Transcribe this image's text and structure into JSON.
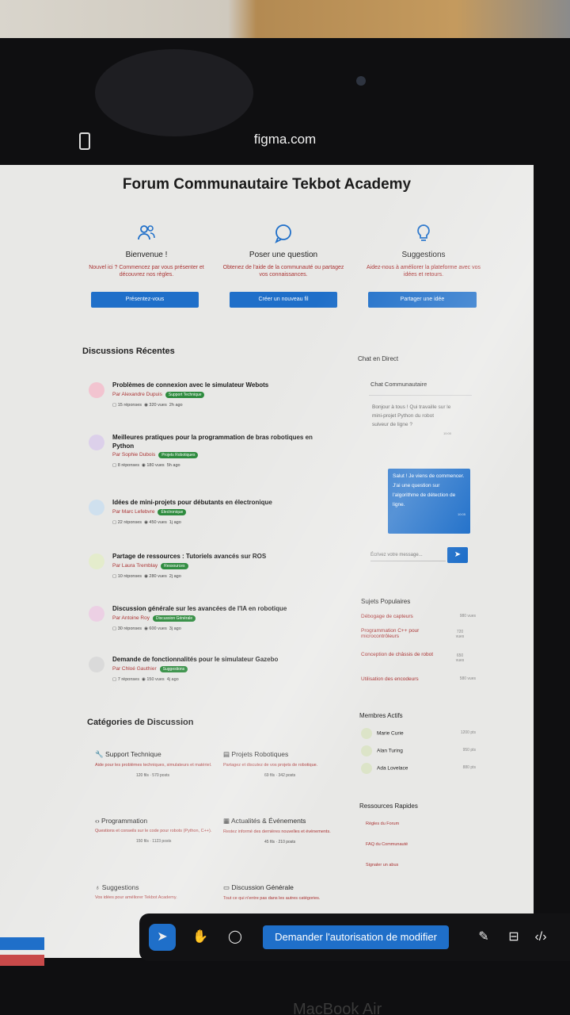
{
  "browser": {
    "url": "figma.com"
  },
  "page": {
    "title": "Forum Communautaire Tekbot Academy"
  },
  "welcome_cards": [
    {
      "title": "Bienvenue !",
      "desc": "Nouvel ici ? Commencez par vous présenter et découvrez nos règles.",
      "button": "Présentez-vous",
      "icon": "users-icon"
    },
    {
      "title": "Poser une question",
      "desc": "Obtenez de l'aide de la communauté ou partagez vos connaissances.",
      "button": "Créer un nouveau fil",
      "icon": "chat-bubble-icon"
    },
    {
      "title": "Suggestions",
      "desc": "Aidez-nous à améliorer la plateforme avec vos idées et retours.",
      "button": "Partager une idée",
      "icon": "lightbulb-icon"
    }
  ],
  "discussions": {
    "title": "Discussions Récentes",
    "items": [
      {
        "title": "Problèmes de connexion avec le simulateur Webots",
        "author": "Par Alexandre Dupuis",
        "tag": "Support Technique",
        "replies": "15 réponses",
        "views": "320 vues",
        "time": "2h ago",
        "color": "#f2c4d0"
      },
      {
        "title": "Meilleures pratiques pour la programmation de bras robotiques en Python",
        "author": "Par Sophie Dubois",
        "tag": "Projets Robotiques",
        "replies": "8 réponses",
        "views": "180 vues",
        "time": "5h ago",
        "color": "#dcd0ea"
      },
      {
        "title": "Idées de mini-projets pour débutants en électronique",
        "author": "Par Marc Lefebvre",
        "tag": "Électronique",
        "replies": "22 réponses",
        "views": "450 vues",
        "time": "1j ago",
        "color": "#cfe0ee"
      },
      {
        "title": "Partage de ressources : Tutoriels avancés sur ROS",
        "author": "Par Laura Tremblay",
        "tag": "Ressources",
        "replies": "10 réponses",
        "views": "280 vues",
        "time": "2j ago",
        "color": "#e4eccc"
      },
      {
        "title": "Discussion générale sur les avancées de l'IA en robotique",
        "author": "Par Antoine Roy",
        "tag": "Discussion Générale",
        "replies": "30 réponses",
        "views": "600 vues",
        "time": "3j ago",
        "color": "#ecd0e4"
      },
      {
        "title": "Demande de fonctionnalités pour le simulateur Gazebo",
        "author": "Par Chloé Gauthier",
        "tag": "Suggestions",
        "replies": "7 réponses",
        "views": "150 vues",
        "time": "4j ago",
        "color": "#dadada"
      }
    ]
  },
  "chat": {
    "section_title": "Chat en Direct",
    "title": "Chat Communautaire",
    "msg1": "Bonjour à tous ! Qui travaille sur le mini-projet Python du robot suiveur de ligne ?",
    "msg1_time": "10:00",
    "msg2": "Salut ! Je viens de commencer. J'ai une question sur l'algorithme de détection de ligne.",
    "msg2_time": "10:05",
    "placeholder": "Écrivez votre message...",
    "send_icon": "send-icon"
  },
  "popular": {
    "title": "Sujets Populaires",
    "items": [
      {
        "title": "Débogage de capteurs",
        "views": "980 vues"
      },
      {
        "title": "Programmation C++ pour microcontrôleurs",
        "views": "720 vues"
      },
      {
        "title": "Conception de châssis de robot",
        "views": "650 vues"
      },
      {
        "title": "Utilisation des encodeurs",
        "views": "580 vues"
      }
    ]
  },
  "members": {
    "title": "Membres Actifs",
    "items": [
      {
        "name": "Marie Curie",
        "points": "1200 pts"
      },
      {
        "name": "Alan Turing",
        "points": "950 pts"
      },
      {
        "name": "Ada Lovelace",
        "points": "880 pts"
      }
    ]
  },
  "resources": {
    "title": "Ressources Rapides",
    "items": [
      "Règles du Forum",
      "FAQ du Communauté",
      "Signaler un abus"
    ]
  },
  "categories": {
    "title": "Catégories de Discussion",
    "items": [
      {
        "title": "Support Technique",
        "desc": "Aide pour les problèmes techniques, simulateurs et matériel.",
        "meta": "120 fils  ·  570 posts",
        "icon": "wrench-icon"
      },
      {
        "title": "Projets Robotiques",
        "desc": "Partagez et discutez de vos projets de robotique.",
        "meta": "69 fils  ·  342 posts",
        "icon": "robot-icon"
      },
      {
        "title": "Programmation",
        "desc": "Questions et conseils sur le code pour robots (Python, C++).",
        "meta": "150 fils  ·  1123 posts",
        "icon": "code-icon"
      },
      {
        "title": "Actualités & Événements",
        "desc": "Restez informé des dernières nouvelles et événements.",
        "meta": "45 fils  ·  210 posts",
        "icon": "calendar-icon"
      },
      {
        "title": "Suggestions",
        "desc": "Vos idées pour améliorer Tekbot Academy.",
        "meta": "",
        "icon": "lightbulb-icon"
      },
      {
        "title": "Discussion Générale",
        "desc": "Tout ce qui n'entre pas dans les autres catégories.",
        "meta": "",
        "icon": "chat-square-icon"
      }
    ]
  },
  "toolbar": {
    "request_label": "Demander l'autorisation de modifier"
  },
  "laptop": {
    "brand": "MacBook Air"
  }
}
